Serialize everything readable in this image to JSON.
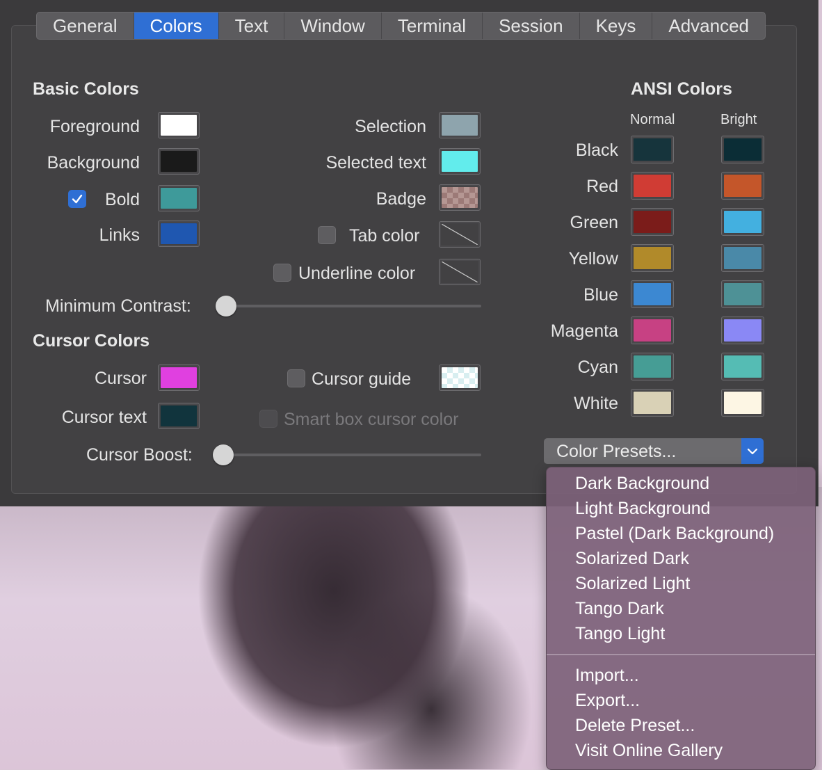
{
  "tabs": [
    {
      "label": "General",
      "active": false
    },
    {
      "label": "Colors",
      "active": true
    },
    {
      "label": "Text",
      "active": false
    },
    {
      "label": "Window",
      "active": false
    },
    {
      "label": "Terminal",
      "active": false
    },
    {
      "label": "Session",
      "active": false
    },
    {
      "label": "Keys",
      "active": false
    },
    {
      "label": "Advanced",
      "active": false
    }
  ],
  "basic": {
    "heading": "Basic Colors",
    "foreground": {
      "label": "Foreground",
      "color": "#ffffff"
    },
    "background": {
      "label": "Background",
      "color": "#1a1a1a"
    },
    "bold": {
      "label": "Bold",
      "checked": true,
      "color": "#3e9a9a"
    },
    "links": {
      "label": "Links",
      "color": "#1f57b0"
    },
    "selection": {
      "label": "Selection",
      "color": "#8ea4ad"
    },
    "selected_text": {
      "label": "Selected text",
      "color": "#62ecec"
    },
    "badge": {
      "label": "Badge",
      "color1": "#b59793",
      "color2": "#9c7a77"
    },
    "tab_color": {
      "label": "Tab color",
      "checked": false
    },
    "underline_color": {
      "label": "Underline color",
      "checked": false
    },
    "min_contrast": {
      "label": "Minimum Contrast:",
      "value": 0
    }
  },
  "cursor": {
    "heading": "Cursor Colors",
    "cursor": {
      "label": "Cursor",
      "color": "#e040e0"
    },
    "cursor_text": {
      "label": "Cursor text",
      "color": "#11343d"
    },
    "cursor_guide": {
      "label": "Cursor guide",
      "checked": false,
      "color1": "#ffffff",
      "color2": "#d8eef0"
    },
    "smart_box": {
      "label": "Smart box cursor color",
      "checked": false,
      "enabled": false
    },
    "cursor_boost": {
      "label": "Cursor Boost:",
      "value": 0
    }
  },
  "ansi": {
    "heading": "ANSI Colors",
    "normal_label": "Normal",
    "bright_label": "Bright",
    "rows": [
      {
        "name": "Black",
        "normal": "#16343c",
        "bright": "#0b2d36"
      },
      {
        "name": "Red",
        "normal": "#d03c34",
        "bright": "#c4562a"
      },
      {
        "name": "Green",
        "normal": "#7b1c1a",
        "bright": "#43b0e0"
      },
      {
        "name": "Yellow",
        "normal": "#b18a2a",
        "bright": "#4a89a8"
      },
      {
        "name": "Blue",
        "normal": "#3c88d2",
        "bright": "#4e9196"
      },
      {
        "name": "Magenta",
        "normal": "#c74183",
        "bright": "#8a88f5"
      },
      {
        "name": "Cyan",
        "normal": "#469d95",
        "bright": "#55bcb4"
      },
      {
        "name": "White",
        "normal": "#d9d1b6",
        "bright": "#fdf6e4"
      }
    ]
  },
  "presets": {
    "button_label": "Color Presets...",
    "menu": {
      "group1": [
        "Dark Background",
        "Light Background",
        "Pastel (Dark Background)",
        "Solarized Dark",
        "Solarized Light",
        "Tango Dark",
        "Tango Light"
      ],
      "group2": [
        "Import...",
        "Export...",
        "Delete Preset...",
        "Visit Online Gallery"
      ]
    }
  },
  "colors": {
    "accent": "#2f6fd4"
  }
}
